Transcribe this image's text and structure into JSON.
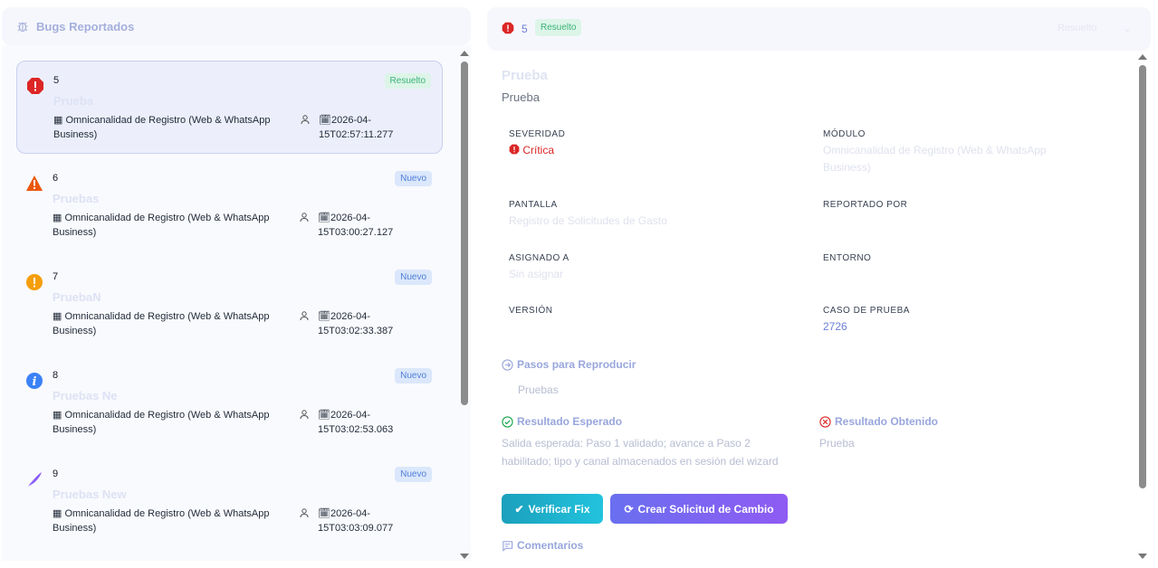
{
  "left": {
    "title": "Bugs Reportados",
    "bugs": [
      {
        "num": "5",
        "title": "Prueba",
        "module": "Omnicanalidad de Registro (Web & WhatsApp Business)",
        "date_line1": "2026-04-",
        "date_line2": "15T02:57:11.277",
        "status": "Resuelto",
        "icon": "critical-octagon-icon"
      },
      {
        "num": "6",
        "title": "Pruebas",
        "module": "Omnicanalidad de Registro (Web & WhatsApp Business)",
        "date_line1": "2026-04-",
        "date_line2": "15T03:00:27.127",
        "status": "Nuevo",
        "icon": "warning-triangle-icon"
      },
      {
        "num": "7",
        "title": "PruebaN",
        "module": "Omnicanalidad de Registro (Web & WhatsApp Business)",
        "date_line1": "2026-04-",
        "date_line2": "15T03:02:33.387",
        "status": "Nuevo",
        "icon": "exclamation-circle-icon"
      },
      {
        "num": "8",
        "title": "Pruebas Ne",
        "module": "Omnicanalidad de Registro (Web & WhatsApp Business)",
        "date_line1": "2026-04-",
        "date_line2": "15T03:02:53.063",
        "status": "Nuevo",
        "icon": "info-circle-icon"
      },
      {
        "num": "9",
        "title": "Pruebas New",
        "module": "Omnicanalidad de Registro (Web & WhatsApp Business)",
        "date_line1": "2026-04-",
        "date_line2": "15T03:03:09.077",
        "status": "Nuevo",
        "icon": "feather-icon"
      }
    ]
  },
  "detail": {
    "num": "5",
    "badge": "Resuelto",
    "status_select": "Resuelto",
    "title": "Prueba",
    "description": "Prueba",
    "severity_label": "SEVERIDAD",
    "severity_value": "Crítica",
    "module_label": "MÓDULO",
    "module_value": "Omnicanalidad de Registro (Web & WhatsApp Business)",
    "screen_label": "PANTALLA",
    "screen_value": "Registro de Solicitudes de Gasto",
    "reported_label": "REPORTADO POR",
    "assigned_label": "ASIGNADO A",
    "assigned_value": "Sin asignar",
    "env_label": "ENTORNO",
    "version_label": "VERSIÓN",
    "testcase_label": "CASO DE PRUEBA",
    "testcase_value": "2726",
    "steps_title": "Pasos para Reproducir",
    "steps_value": "Pruebas",
    "expected_title": "Resultado Esperado",
    "expected_value": "Salida esperada: Paso 1 validado; avance a Paso 2 habilitado; tipo y canal almacenados en sesión del wizard",
    "obtained_title": "Resultado Obtenido",
    "obtained_value": "Prueba",
    "verify_button": "Verificar Fix",
    "change_button": "Crear Solicitud de Cambio",
    "comments_title": "Comentarios"
  },
  "colors": {
    "critical": "#dc2626",
    "warning": "#ea580c",
    "medium": "#f59e0b",
    "info": "#3b82f6",
    "feather": "#8b5cf6",
    "accent": "#6a7ed6"
  }
}
